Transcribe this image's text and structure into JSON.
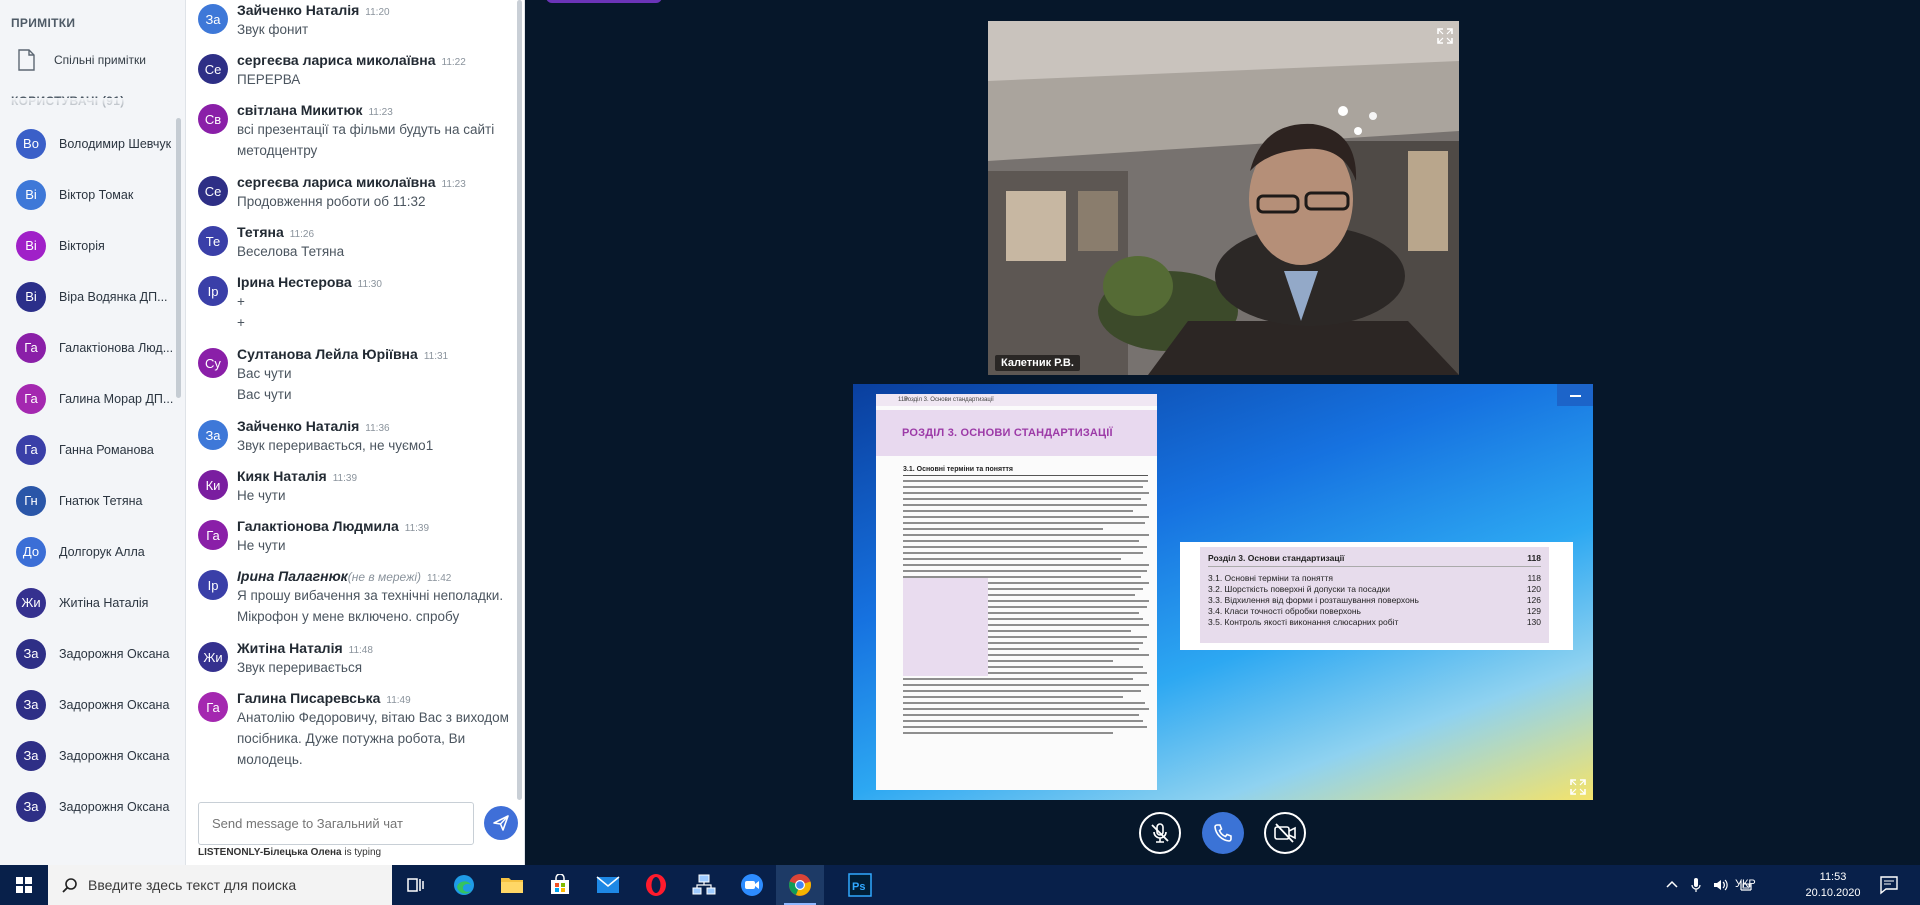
{
  "users_panel": {
    "notes_title": "ПРИМІТКИ",
    "shared_notes_label": "Спільні примітки",
    "users_title": "КОРИСТУВАЧІ (91)",
    "users": [
      {
        "initials": "Во",
        "name": "Володимир Шевчук",
        "color": "#3a5fc8",
        "mic": "none"
      },
      {
        "initials": "Ві",
        "name": "Віктор Томак",
        "color": "#3e78d8",
        "mic": "on"
      },
      {
        "initials": "Ві",
        "name": "Вікторія",
        "color": "#a020c8",
        "mic": "muted"
      },
      {
        "initials": "Ві",
        "name": "Віра Водянка ДП...",
        "color": "#2b2f8a",
        "mic": "none"
      },
      {
        "initials": "Га",
        "name": "Галактіонова Люд...",
        "color": "#8a1fa8",
        "mic": "on"
      },
      {
        "initials": "Га",
        "name": "Галина Морар ДП...",
        "color": "#a428b0",
        "mic": "on"
      },
      {
        "initials": "Га",
        "name": "Ганна Романова",
        "color": "#3a3fa8",
        "mic": "none"
      },
      {
        "initials": "Гн",
        "name": "Гнатюк Тетяна",
        "color": "#2a56a8",
        "mic": "none"
      },
      {
        "initials": "До",
        "name": "Долгорук Алла",
        "color": "#3b6ed6",
        "mic": "on"
      },
      {
        "initials": "Жи",
        "name": "Житіна Наталія",
        "color": "#35318f",
        "mic": "on"
      },
      {
        "initials": "За",
        "name": "Задорожня Оксана",
        "color": "#2e2f86",
        "mic": "none"
      },
      {
        "initials": "За",
        "name": "Задорожня Оксана",
        "color": "#2e2f86",
        "mic": "on"
      },
      {
        "initials": "За",
        "name": "Задорожня Оксана",
        "color": "#2e2f86",
        "mic": "on"
      },
      {
        "initials": "За",
        "name": "Задорожня Оксана",
        "color": "#2e2f86",
        "mic": "on"
      }
    ]
  },
  "chat": {
    "messages": [
      {
        "initials": "За",
        "color": "#3e78d8",
        "name": "Зайченко Наталія",
        "time": "11:20",
        "offline": "",
        "lines": [
          "Звук фонит"
        ]
      },
      {
        "initials": "Се",
        "color": "#2e2f86",
        "name": "сергеєва лариса миколаївна",
        "time": "11:22",
        "offline": "",
        "lines": [
          "ПЕРЕРВА"
        ]
      },
      {
        "initials": "Св",
        "color": "#8a1fa8",
        "name": "світлана Микитюк",
        "time": "11:23",
        "offline": "",
        "lines": [
          "всі презентації та фільми будуть на сайті",
          "методцентру"
        ]
      },
      {
        "initials": "Се",
        "color": "#2e2f86",
        "name": "сергеєва лариса миколаївна",
        "time": "11:23",
        "offline": "",
        "lines": [
          "Продовження роботи об 11:32"
        ]
      },
      {
        "initials": "Те",
        "color": "#3a3fa8",
        "name": "Тетяна",
        "time": "11:26",
        "offline": "",
        "lines": [
          "Веселова Тетяна"
        ]
      },
      {
        "initials": "Ір",
        "color": "#3a3fa8",
        "name": "Ірина Нестерова",
        "time": "11:30",
        "offline": "",
        "lines": [
          "+",
          "+"
        ]
      },
      {
        "initials": "Су",
        "color": "#8a1fa8",
        "name": "Султанова Лейла Юріївна",
        "time": "11:31",
        "offline": "",
        "lines": [
          "Вас чути",
          "Вас чути"
        ]
      },
      {
        "initials": "За",
        "color": "#3e78d8",
        "name": "Зайченко Наталія",
        "time": "11:36",
        "offline": "",
        "lines": [
          "Звук переривається, не чуємо1"
        ]
      },
      {
        "initials": "Ки",
        "color": "#7a1ea0",
        "name": "Кияк Наталія",
        "time": "11:39",
        "offline": "",
        "lines": [
          "Не чути"
        ]
      },
      {
        "initials": "Га",
        "color": "#8a1fa8",
        "name": "Галактіонова Людмила",
        "time": "11:39",
        "offline": "",
        "lines": [
          "Не чути"
        ]
      },
      {
        "initials": "Ір",
        "color": "#3a3fa8",
        "name": "Ірина Палагнюк",
        "time": "11:42",
        "offline": "(не в мережі)",
        "lines": [
          "Я прошу вибачення за технічні неполадки.",
          "Мікрофон у мене включено. спробу"
        ]
      },
      {
        "initials": "Жи",
        "color": "#35318f",
        "name": "Житіна Наталія",
        "time": "11:48",
        "offline": "",
        "lines": [
          "Звук переривається"
        ]
      },
      {
        "initials": "Га",
        "color": "#a428b0",
        "name": "Галина Писаревська",
        "time": "11:49",
        "offline": "",
        "lines": [
          "Анатолію Федоровичу, вітаю Вас з виходом",
          "посібника. Дуже потужна робота, Ви",
          "молодець."
        ]
      }
    ],
    "input_placeholder": "Send message to Загальний чат",
    "typing_user": "LISTENONLY-Білецька Олена",
    "typing_suffix": " is typing"
  },
  "webcam": {
    "label": "Калетник Р.В."
  },
  "slide": {
    "book_page_number": "118",
    "book_header": "Розділ 3. Основи стандартизації",
    "book_title": "РОЗДІЛ 3. ОСНОВИ СТАНДАРТИЗАЦІЇ",
    "book_subtitle": "3.1. Основні терміни та поняття",
    "toc_title": "Розділ 3. Основи стандартизації",
    "toc_title_page": "118",
    "toc": [
      {
        "label": "3.1. Основні терміни та поняття",
        "page": "118"
      },
      {
        "label": "3.2. Шорсткість поверхні й допуски та посадки",
        "page": "120"
      },
      {
        "label": "3.3. Відхилення від форми і розташування поверхонь",
        "page": "126"
      },
      {
        "label": "3.4. Класи точності обробки поверхонь",
        "page": "129"
      },
      {
        "label": "3.5. Контроль якості виконання слюсарних робіт",
        "page": "130"
      }
    ]
  },
  "taskbar": {
    "search_placeholder": "Введите здесь текст для поиска",
    "language": "УКР",
    "time": "11:53",
    "date": "20.10.2020"
  },
  "colors": {
    "accent": "#3b73d6",
    "mic_on": "#16a085",
    "mic_muted": "#e74c3c",
    "presentation_bg": "#06172a"
  }
}
